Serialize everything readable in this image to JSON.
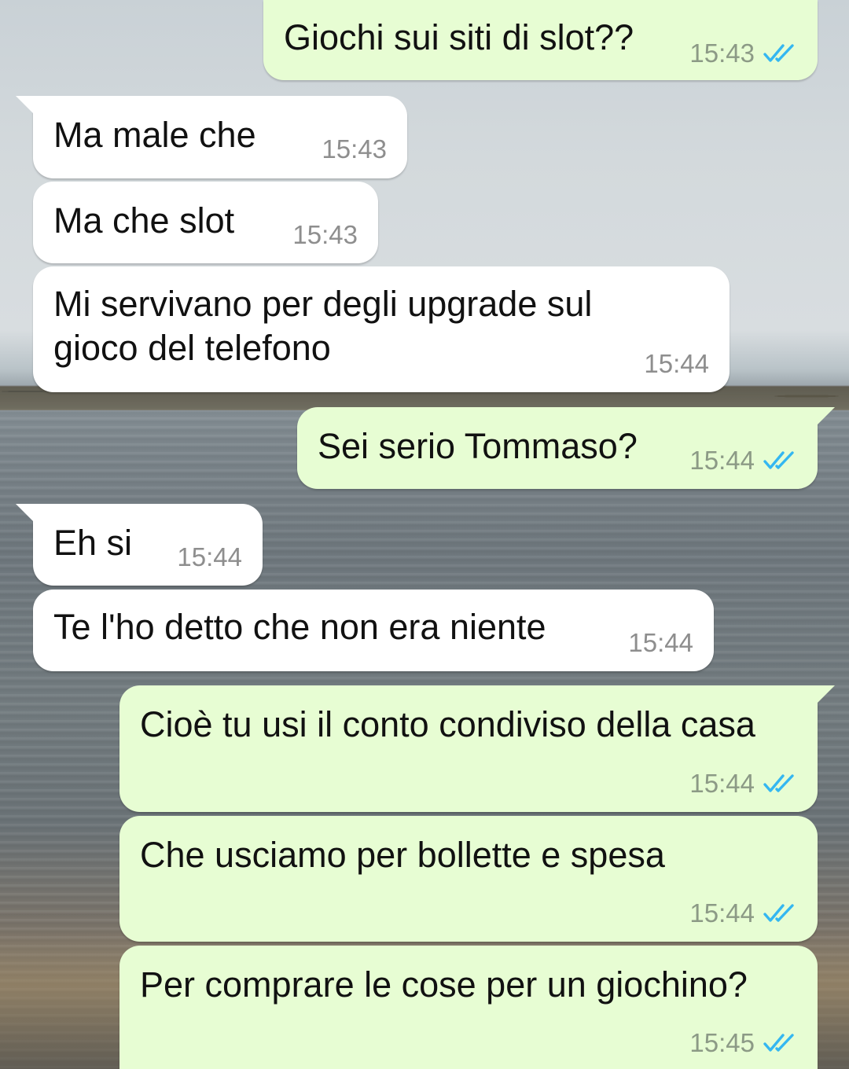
{
  "chat": {
    "messages": [
      {
        "direction": "out",
        "text": "Giochi sui siti di slot??",
        "time": "15:43",
        "status_icon": "double-check-read-icon"
      },
      {
        "direction": "in",
        "text": "Ma male che",
        "time": "15:43"
      },
      {
        "direction": "in",
        "text": "Ma che slot",
        "time": "15:43"
      },
      {
        "direction": "in",
        "text": "Mi servivano per degli upgrade sul\ngioco del telefono",
        "time": "15:44"
      },
      {
        "direction": "out",
        "text": "Sei serio Tommaso?",
        "time": "15:44",
        "status_icon": "double-check-read-icon"
      },
      {
        "direction": "in",
        "text": "Eh si",
        "time": "15:44"
      },
      {
        "direction": "in",
        "text": "Te l'ho detto che non era niente",
        "time": "15:44"
      },
      {
        "direction": "out",
        "text": "Cioè tu usi il conto condiviso della casa",
        "time": "15:44",
        "status_icon": "double-check-read-icon"
      },
      {
        "direction": "out",
        "text": "Che usciamo per bollette e spesa",
        "time": "15:44",
        "status_icon": "double-check-read-icon"
      },
      {
        "direction": "out",
        "text": "Per comprare le cose per un giochino?",
        "time": "15:45",
        "status_icon": "double-check-read-icon"
      }
    ]
  },
  "colors": {
    "outgoing_bubble": "#e7fdd3",
    "incoming_bubble": "#ffffff",
    "read_ticks": "#34b7f1"
  }
}
